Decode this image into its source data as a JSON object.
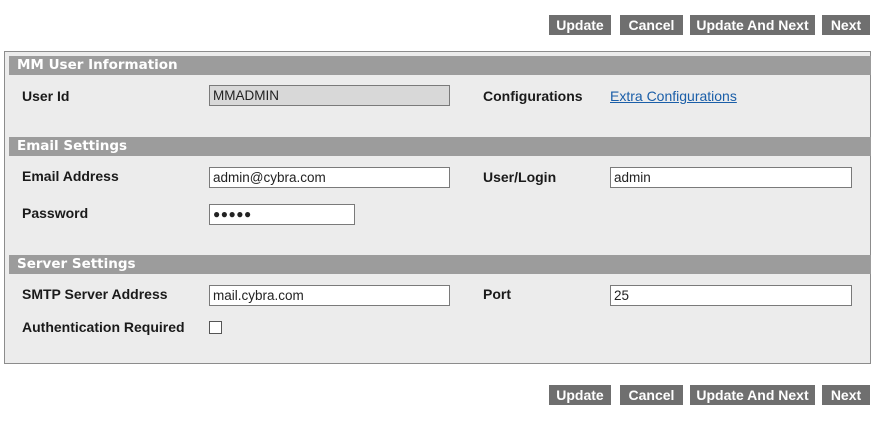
{
  "toolbar": {
    "update_label": "Update",
    "cancel_label": "Cancel",
    "update_and_next_label": "Update And Next",
    "next_label": "Next"
  },
  "user_info": {
    "header": "MM User Information",
    "user_id_label": "User Id",
    "user_id_value": "MMADMIN",
    "configurations_label": "Configurations",
    "configurations_link": "Extra Configurations"
  },
  "email_settings": {
    "header": "Email Settings",
    "email_label": "Email Address",
    "email_value": "admin@cybra.com",
    "login_label": "User/Login",
    "login_value": "admin",
    "password_label": "Password",
    "password_value": "●●●●●"
  },
  "server_settings": {
    "header": "Server Settings",
    "smtp_label": "SMTP Server Address",
    "smtp_value": "mail.cybra.com",
    "port_label": "Port",
    "port_value": "25",
    "auth_label": "Authentication Required",
    "auth_checked": false
  }
}
